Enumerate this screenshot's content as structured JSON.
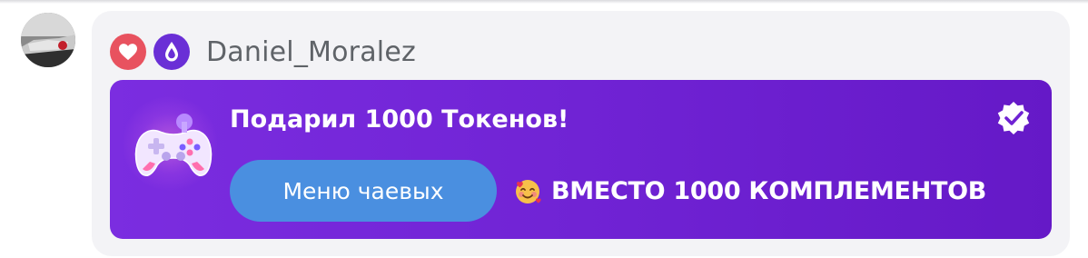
{
  "user": {
    "name": "Daniel_Moralez",
    "badges": [
      "heart-icon",
      "drop-icon"
    ]
  },
  "tip_card": {
    "title": "Подарил 1000 Токенов!",
    "button_label": "Меню чаевых",
    "promo_text": "ВМЕСТО 1000 КОМПЛЕМЕНТОВ",
    "icons": [
      "gamepad-icon",
      "verified-icon",
      "smiling-face-with-hearts-icon"
    ]
  },
  "colors": {
    "card_gradient_start": "#7b2de0",
    "card_gradient_end": "#6519c7",
    "button": "#4a8fe0",
    "heart_badge": "#e8525f",
    "drop_badge": "#6a2fd6",
    "bubble_bg": "#f3f3f6",
    "username_text": "#5f6368"
  }
}
